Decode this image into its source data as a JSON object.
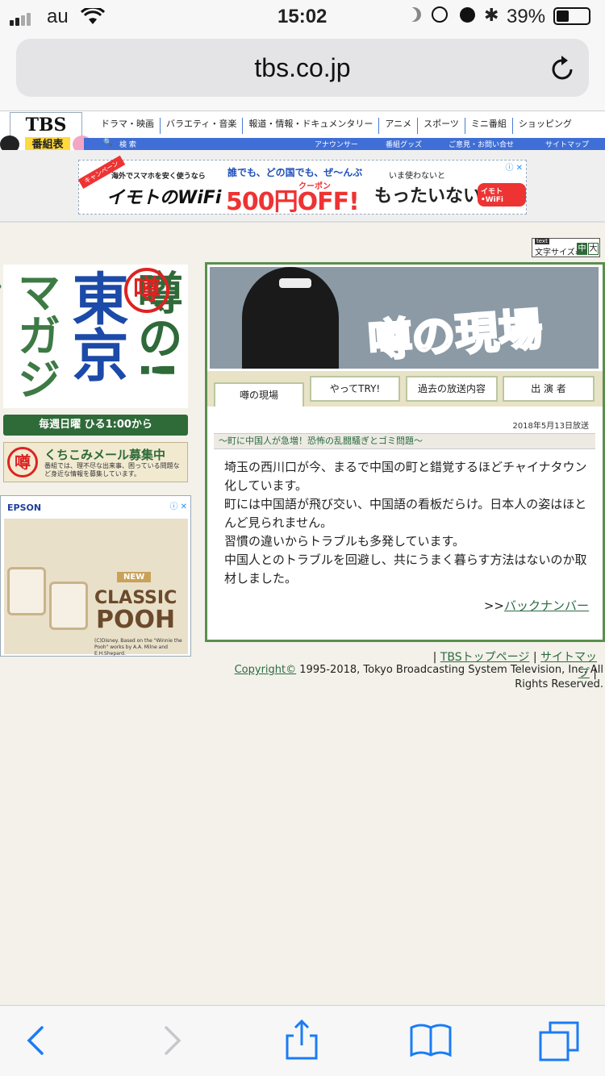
{
  "status": {
    "carrier": "au",
    "time": "15:02",
    "battery": "39%"
  },
  "browser": {
    "url": "tbs.co.jp"
  },
  "header": {
    "logo": "TBS",
    "logo_sub": "番組表",
    "nav": [
      "ドラマ・映画",
      "バラエティ・音楽",
      "報道・情報・ドキュメンタリー",
      "アニメ",
      "スポーツ",
      "ミニ番組",
      "ショッピング"
    ],
    "search": "検 索",
    "links": [
      "アナウンサー",
      "番組グッズ",
      "ご意見・お問い合せ",
      "サイトマップ"
    ]
  },
  "ad": {
    "ribbon": "キャンペーン",
    "line1": "海外でスマホを安く使うなら",
    "brand": "イモトのWiFi",
    "promo_top": "誰でも、どの国でも、ぜ〜んぶ",
    "coupon": "クーポン",
    "amount": "500円OFF!",
    "right_top": "いま使わないと",
    "right": "もったいない。",
    "badge": "イモト•WiFi"
  },
  "text_size": {
    "label": "文字サイズ»",
    "mid": "中",
    "large": "大",
    "tag": "text"
  },
  "left": {
    "title_a": "マガジン",
    "title_b": "東京",
    "title_c": "噂の!",
    "stamp": "噂",
    "broadcast": "毎週日曜 ひる1:00から",
    "mail_title": "くちこみメール募集中",
    "mail_body": "番組では、理不尽な出来事、困っている問題など身近な情報を募集しています。",
    "mail_stamp": "噂"
  },
  "epson": {
    "brand": "EPSON",
    "new": "NEW",
    "line1": "CLASSIC",
    "line2": "POOH",
    "credit": "(C)Disney. Based on the \"Winnie the Pooh\" works by A.A. Milne and E.H.Shepard."
  },
  "panel": {
    "banner_text": "噂の現場",
    "tabs": [
      "噂の現場",
      "やってTRY!",
      "過去の放送内容",
      "出 演 者"
    ],
    "date": "2018年5月13日放送",
    "subtitle": "〜町に中国人が急増！恐怖の乱闘騒ぎとゴミ問題〜",
    "article": [
      "埼玉の西川口が今、まるで中国の町と錯覚するほどチャイナタウン化しています。",
      "町には中国語が飛び交い、中国語の看板だらけ。日本人の姿はほとんど見られません。",
      "習慣の違いからトラブルも多発しています。",
      "中国人とのトラブルを回避し、共にうまく暮らす方法はないのか取材しました。"
    ],
    "back_prefix": ">>",
    "back_link": "バックナンバー"
  },
  "footer": {
    "links": [
      "TBSトップページ",
      "サイトマップ"
    ],
    "copyright_link": "Copyright©",
    "copyright_text": " 1995-2018, Tokyo Broadcasting System Television, Inc. All Rights Reserved."
  }
}
